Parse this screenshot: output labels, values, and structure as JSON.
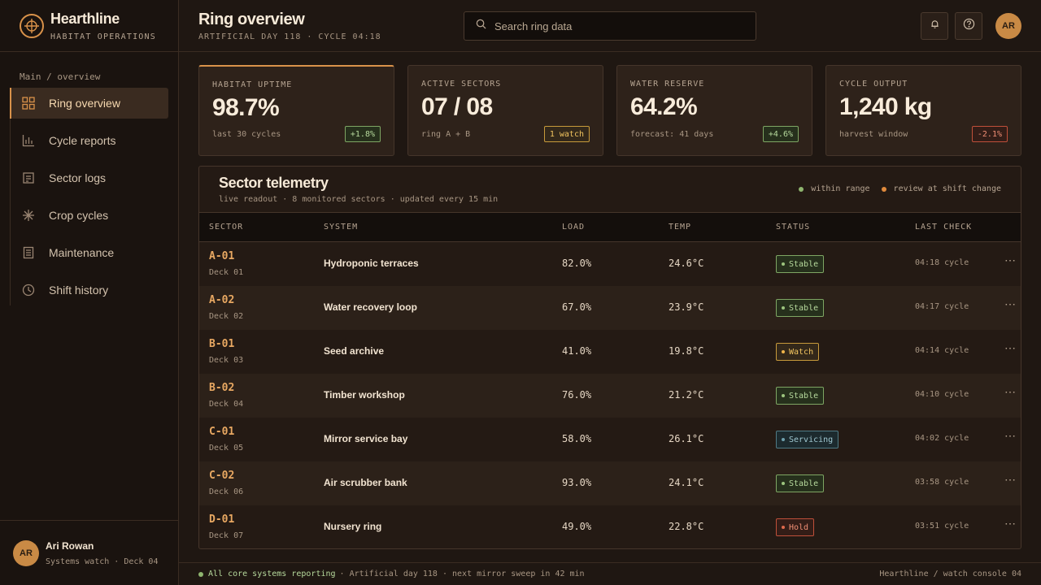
{
  "brand": {
    "name": "Hearthline",
    "subtitle": "HABITAT OPERATIONS"
  },
  "sidebar": {
    "breadcrumb": "Main / overview",
    "items": [
      {
        "label": "Ring overview",
        "icon": "grid-icon",
        "active": true
      },
      {
        "label": "Cycle reports",
        "icon": "bar-chart-icon"
      },
      {
        "label": "Sector logs",
        "icon": "log-icon"
      },
      {
        "label": "Crop cycles",
        "icon": "sprout-icon"
      },
      {
        "label": "Maintenance",
        "icon": "clipboard-icon"
      },
      {
        "label": "Shift history",
        "icon": "clock-icon"
      }
    ],
    "user": {
      "initials": "AR",
      "name": "Ari Rowan",
      "meta": "Systems watch · Deck 04"
    }
  },
  "header": {
    "title": "Ring overview",
    "subtitle": "ARTIFICIAL DAY 118 · CYCLE 04:18",
    "search_placeholder": "Search ring data",
    "avatar_initials": "AR"
  },
  "kpis": [
    {
      "label": "HABITAT UPTIME",
      "value": "98.7%",
      "foot": "last 30 cycles",
      "badge": "+1.8%",
      "tone": "good"
    },
    {
      "label": "ACTIVE SECTORS",
      "value": "07 / 08",
      "foot": "ring A + B",
      "badge": "1 watch",
      "tone": "warn"
    },
    {
      "label": "WATER RESERVE",
      "value": "64.2%",
      "foot": "forecast: 41 days",
      "badge": "+4.6%",
      "tone": "good"
    },
    {
      "label": "CYCLE OUTPUT",
      "value": "1,240 kg",
      "foot": "harvest window",
      "badge": "-2.1%",
      "tone": "bad"
    }
  ],
  "panel": {
    "title": "Sector telemetry",
    "subtitle": "live readout · 8 monitored sectors · updated every 15 min",
    "legend": [
      {
        "label": "within range",
        "color": "#8fb56f"
      },
      {
        "label": "review at shift change",
        "color": "#e08a3c"
      }
    ],
    "columns": [
      "SECTOR",
      "SYSTEM",
      "LOAD",
      "TEMP",
      "STATUS",
      "LAST CHECK"
    ],
    "rows": [
      {
        "sector": "A-01",
        "deck": "Deck 01",
        "system": "Hydroponic terraces",
        "load": "82.0%",
        "temp": "24.6°C",
        "status": "Stable",
        "kind": "stable",
        "check": "04:18 cycle"
      },
      {
        "sector": "A-02",
        "deck": "Deck 02",
        "system": "Water recovery loop",
        "load": "67.0%",
        "temp": "23.9°C",
        "status": "Stable",
        "kind": "stable",
        "check": "04:17 cycle"
      },
      {
        "sector": "B-01",
        "deck": "Deck 03",
        "system": "Seed archive",
        "load": "41.0%",
        "temp": "19.8°C",
        "status": "Watch",
        "kind": "watch",
        "check": "04:14 cycle"
      },
      {
        "sector": "B-02",
        "deck": "Deck 04",
        "system": "Timber workshop",
        "load": "76.0%",
        "temp": "21.2°C",
        "status": "Stable",
        "kind": "stable",
        "check": "04:10 cycle"
      },
      {
        "sector": "C-01",
        "deck": "Deck 05",
        "system": "Mirror service bay",
        "load": "58.0%",
        "temp": "26.1°C",
        "status": "Servicing",
        "kind": "servicing",
        "check": "04:02 cycle"
      },
      {
        "sector": "C-02",
        "deck": "Deck 06",
        "system": "Air scrubber bank",
        "load": "93.0%",
        "temp": "24.1°C",
        "status": "Stable",
        "kind": "stable",
        "check": "03:58 cycle"
      },
      {
        "sector": "D-01",
        "deck": "Deck 07",
        "system": "Nursery ring",
        "load": "49.0%",
        "temp": "22.8°C",
        "status": "Hold",
        "kind": "hold",
        "check": "03:51 cycle"
      }
    ]
  },
  "footer": {
    "ok": "All core systems reporting",
    "info": "· Artificial day 118 · next mirror sweep in 42 min",
    "right": "Hearthline / watch console 04"
  }
}
